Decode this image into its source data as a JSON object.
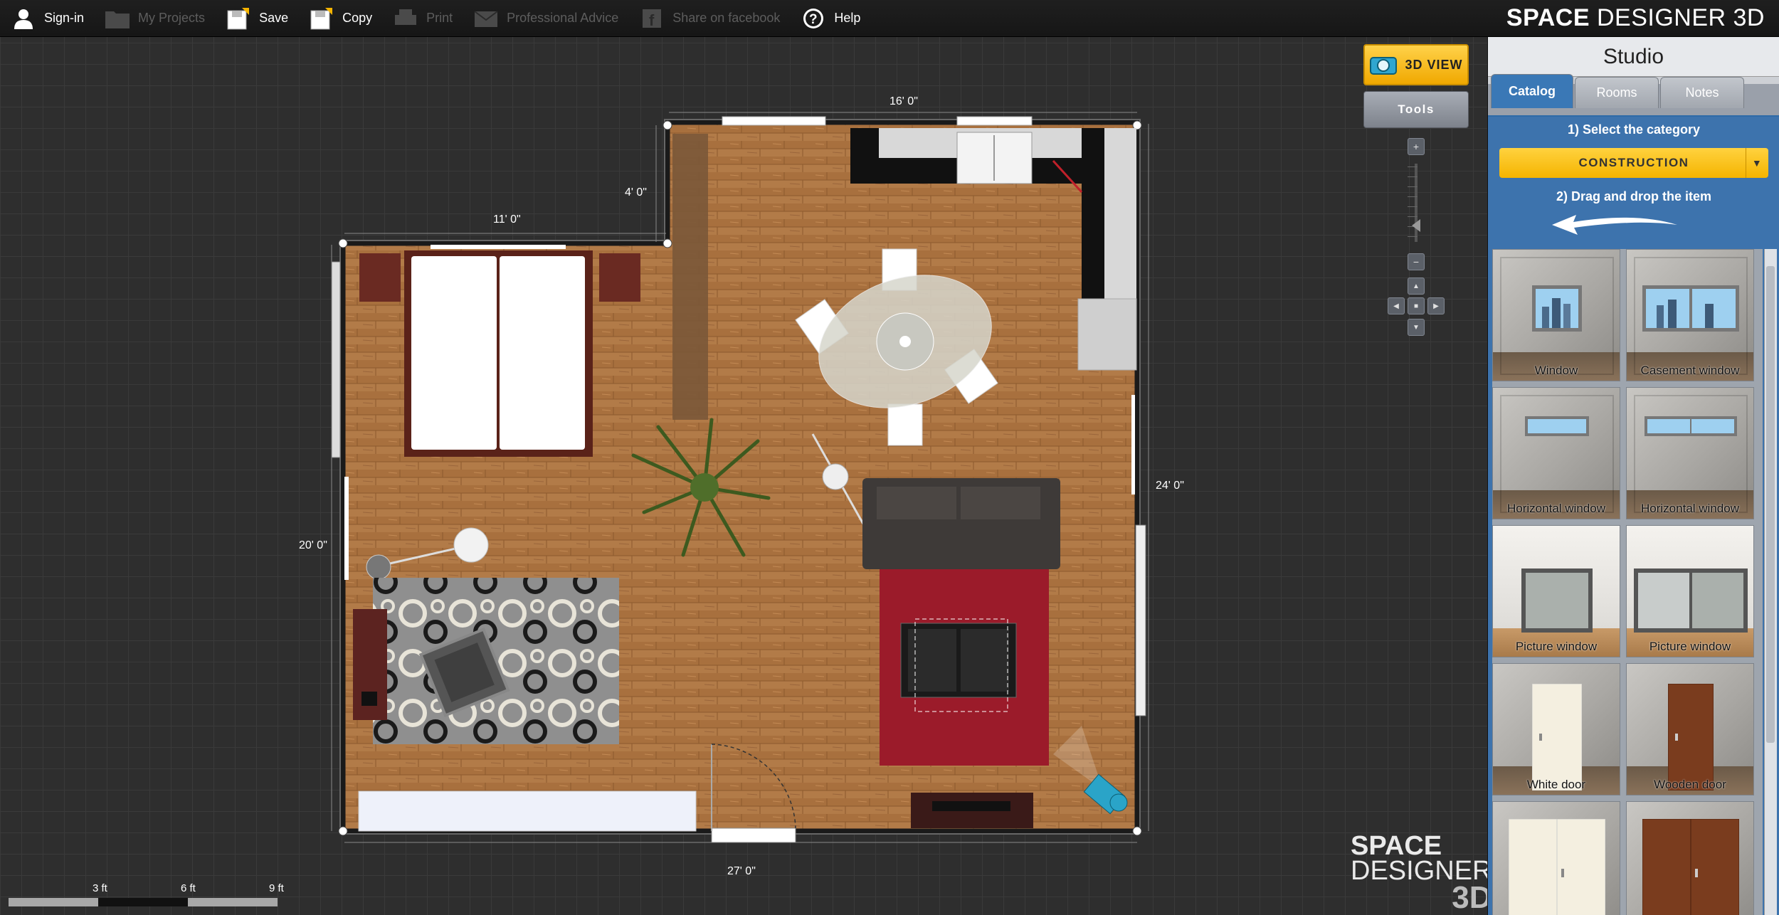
{
  "toolbar": {
    "signin": "Sign-in",
    "my_projects": "My Projects",
    "save": "Save",
    "copy": "Copy",
    "print": "Print",
    "professional_advice": "Professional Advice",
    "share_facebook": "Share on facebook",
    "help": "Help"
  },
  "brand": {
    "bold": "SPACE",
    "regular": " DESIGNER 3D"
  },
  "plan": {
    "dimensions": {
      "top": "16' 0\"",
      "top_left": "11' 0\"",
      "notch": "4' 0\"",
      "left": "20' 0\"",
      "right": "24' 0\"",
      "bottom": "27' 0\""
    }
  },
  "controls": {
    "view3d": "3D VIEW",
    "tools": "Tools"
  },
  "scale": {
    "labels": [
      "3 ft",
      "6 ft",
      "9 ft"
    ]
  },
  "watermark": {
    "line1": "SPACE",
    "line2": "DESIGNER",
    "line3": "3D"
  },
  "panel": {
    "title": "Studio",
    "tabs": [
      "Catalog",
      "Rooms",
      "Notes"
    ],
    "active_tab": "Catalog",
    "step1": "1) Select the category",
    "category": "CONSTRUCTION",
    "step2": "2) Drag and drop the item",
    "items": [
      {
        "label": "Window",
        "kind": "window"
      },
      {
        "label": "Casement window",
        "kind": "casement"
      },
      {
        "label": "Horizontal window",
        "kind": "hwindow"
      },
      {
        "label": "Horizontal window",
        "kind": "hwindow2"
      },
      {
        "label": "Picture window",
        "kind": "picture"
      },
      {
        "label": "Picture window",
        "kind": "picture2"
      },
      {
        "label": "White door",
        "kind": "whitedoor"
      },
      {
        "label": "Wooden door",
        "kind": "wooddoor"
      },
      {
        "label": "",
        "kind": "whitedouble"
      },
      {
        "label": "",
        "kind": "wooddouble"
      }
    ]
  },
  "colors": {
    "accent_yellow": "#f5b400",
    "panel_blue": "#3a78b6",
    "floor_wood": "#b07a4a",
    "rug_red": "#9b1b2a"
  }
}
